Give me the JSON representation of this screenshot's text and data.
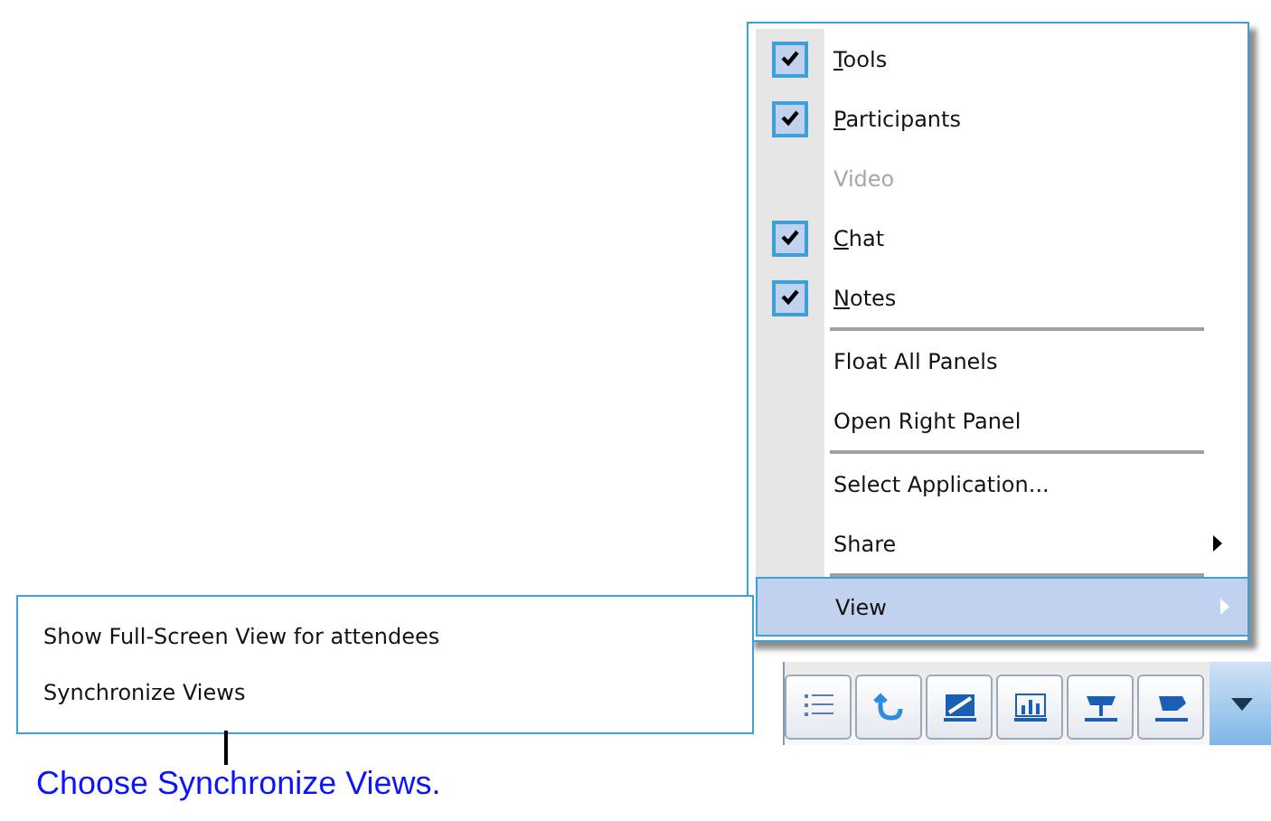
{
  "view_menu": {
    "items": [
      {
        "kind": "check",
        "label": "Tools",
        "checked": true,
        "disabled": false,
        "access_key": true,
        "selected": false
      },
      {
        "kind": "check",
        "label": "Participants",
        "checked": true,
        "disabled": false,
        "access_key": true,
        "selected": false
      },
      {
        "kind": "check",
        "label": "Video",
        "checked": false,
        "disabled": true,
        "access_key": false,
        "selected": false
      },
      {
        "kind": "check",
        "label": "Chat",
        "checked": true,
        "disabled": false,
        "access_key": true,
        "selected": false
      },
      {
        "kind": "check",
        "label": "Notes",
        "checked": true,
        "disabled": false,
        "access_key": true,
        "selected": false
      },
      {
        "kind": "separator"
      },
      {
        "kind": "plain",
        "label": "Float All Panels",
        "disabled": false,
        "access_key": false,
        "selected": false
      },
      {
        "kind": "plain",
        "label": "Open Right Panel",
        "disabled": false,
        "access_key": false,
        "selected": false
      },
      {
        "kind": "separator"
      },
      {
        "kind": "plain",
        "label": "Select Application...",
        "disabled": false,
        "access_key": false,
        "selected": false
      },
      {
        "kind": "submenu",
        "label": "Share",
        "disabled": false,
        "access_key": false,
        "selected": false
      },
      {
        "kind": "separator"
      },
      {
        "kind": "submenu",
        "label": "View",
        "disabled": false,
        "access_key": false,
        "selected": true
      }
    ]
  },
  "submenu": {
    "items": [
      {
        "label": "Show Full-Screen View for attendees",
        "selected": false
      },
      {
        "label": "Synchronize Views",
        "selected": false
      }
    ]
  },
  "callout": {
    "text": "Choose Synchronize Views."
  }
}
